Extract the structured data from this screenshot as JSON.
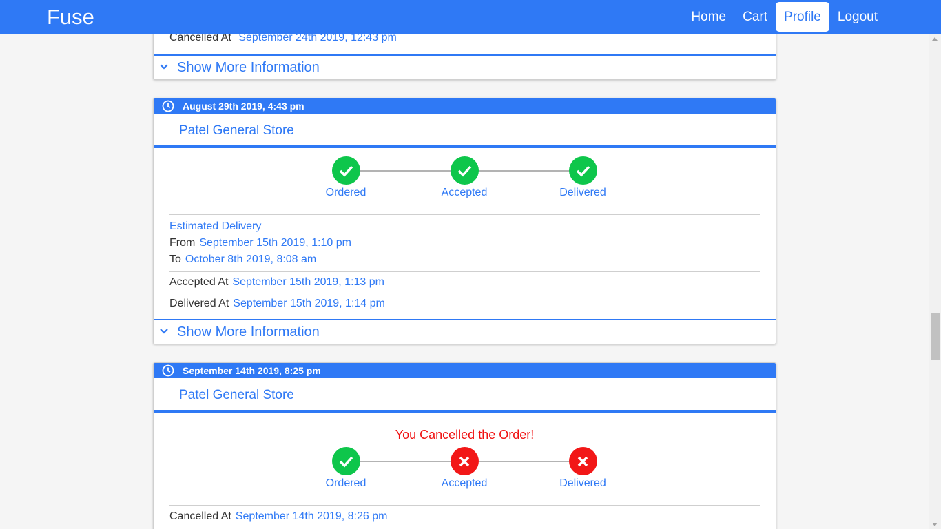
{
  "nav": {
    "brand": "Fuse",
    "links": [
      {
        "label": "Home",
        "active": false
      },
      {
        "label": "Cart",
        "active": false
      },
      {
        "label": "Profile",
        "active": true
      },
      {
        "label": "Logout",
        "active": false
      }
    ]
  },
  "colors": {
    "primary": "#2f79f5",
    "success": "#0ec64b",
    "danger": "#f21717"
  },
  "cards": [
    {
      "cancelled_label": "Cancelled At",
      "cancelled_value": "September 24th 2019, 12:43 pm",
      "show_more": "Show More Information"
    },
    {
      "header": "August 29th 2019, 4:43 pm",
      "store": "Patel General Store",
      "steps": [
        {
          "label": "Ordered",
          "status": "check-icon"
        },
        {
          "label": "Accepted",
          "status": "check-icon"
        },
        {
          "label": "Delivered",
          "status": "check-icon"
        }
      ],
      "estimated_label": "Estimated Delivery",
      "from_label": "From",
      "from_value": "September 15th 2019, 1:10 pm",
      "to_label": "To",
      "to_value": "October 8th 2019, 8:08 am",
      "accepted_label": "Accepted At",
      "accepted_value": "September 15th 2019, 1:13 pm",
      "delivered_label": "Delivered At",
      "delivered_value": "September 15th 2019, 1:14 pm",
      "show_more": "Show More Information"
    },
    {
      "header": "September 14th 2019, 8:25 pm",
      "store": "Patel General Store",
      "message": "You Cancelled the Order!",
      "steps": [
        {
          "label": "Ordered",
          "status": "check-icon"
        },
        {
          "label": "Accepted",
          "status": "cross-icon"
        },
        {
          "label": "Delivered",
          "status": "cross-icon"
        }
      ],
      "cancelled_label": "Cancelled At",
      "cancelled_value": "September 14th 2019, 8:26 pm"
    }
  ]
}
